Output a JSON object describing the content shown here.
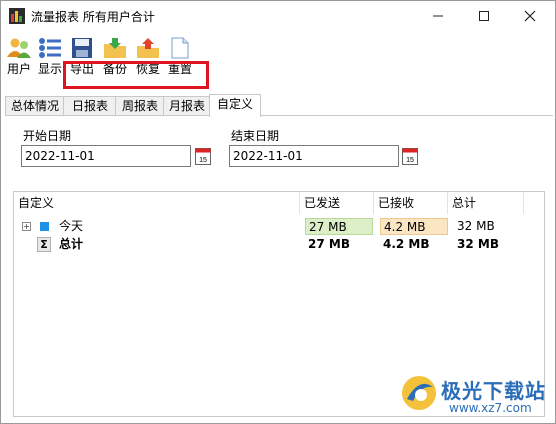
{
  "window": {
    "title": "流量报表 所有用户合计"
  },
  "toolbar": {
    "users": "用户",
    "display": "显示",
    "export": "导出",
    "backup": "备份",
    "restore": "恢复",
    "reset": "重置"
  },
  "tabs": [
    "总体情况",
    "日报表",
    "周报表",
    "月报表",
    "自定义"
  ],
  "filters": {
    "start_label": "开始日期",
    "start_value": "2022-11-01",
    "end_label": "结束日期",
    "end_value": "2022-11-01",
    "calendar_day": "15"
  },
  "table": {
    "columns": [
      "自定义",
      "已发送",
      "已接收",
      "总计"
    ],
    "rows": [
      {
        "name": "今天",
        "sent": "27 MB",
        "received": "4.2 MB",
        "total": "32 MB"
      },
      {
        "name": "总计",
        "sent": "27 MB",
        "received": "4.2 MB",
        "total": "32 MB"
      }
    ]
  },
  "watermark": {
    "name": "极光下载站",
    "url": "www.xz7.com"
  },
  "colors": {
    "highlight": "#e0141e",
    "sent_bar": "#dcefc9",
    "received_bar": "#fbe6c4",
    "accent": "#1e90e6"
  }
}
